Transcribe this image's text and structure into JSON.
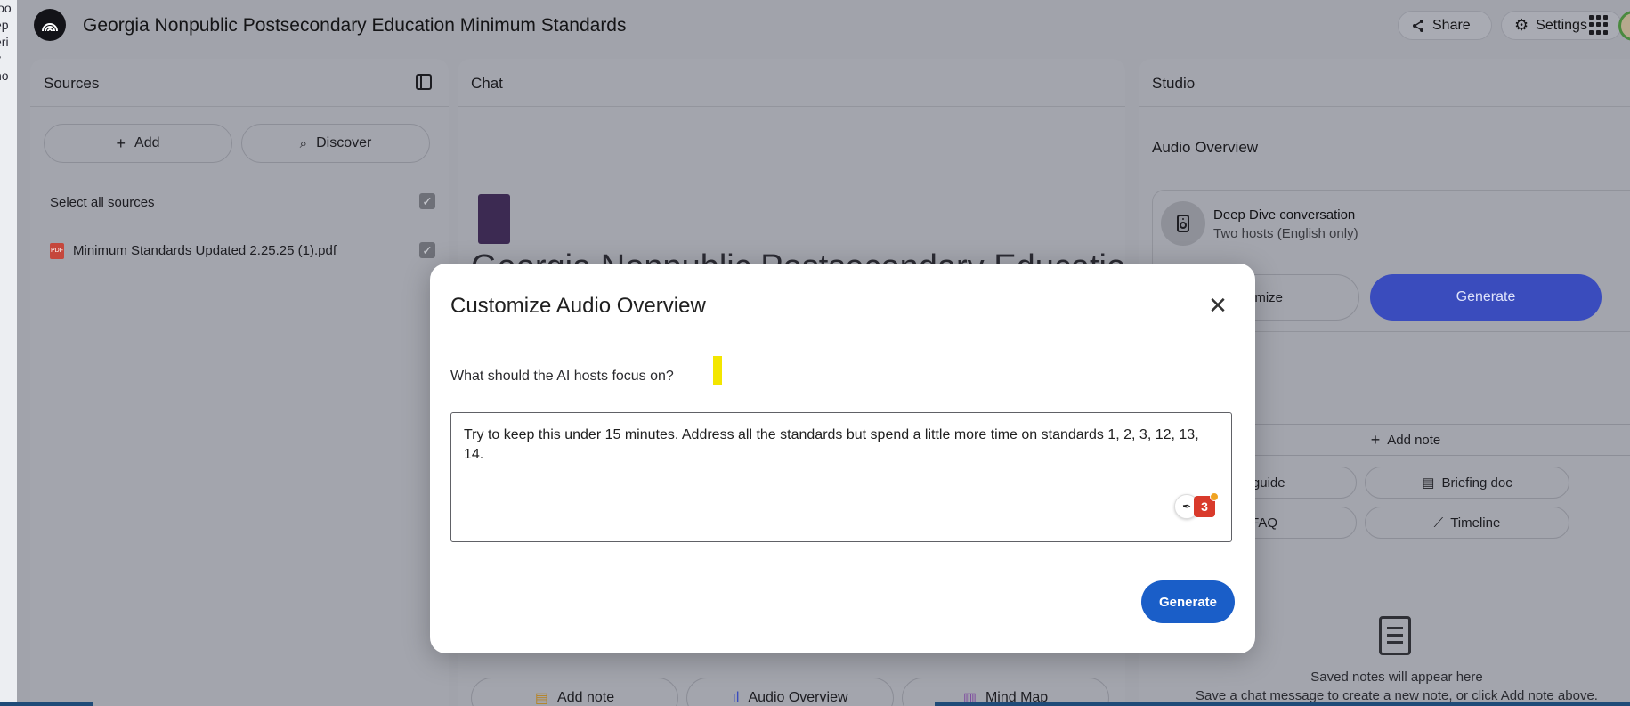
{
  "edge_text": [
    "loo",
    "ep",
    "eri",
    "y",
    "ho"
  ],
  "header": {
    "app_title": "Georgia Nonpublic Postsecondary Education Minimum Standards",
    "share_label": "Share",
    "settings_label": "Settings"
  },
  "sources": {
    "title": "Sources",
    "add_label": "Add",
    "discover_label": "Discover",
    "select_all_label": "Select all sources",
    "items": [
      {
        "name": "Minimum Standards Updated 2.25.25 (1).pdf",
        "checked": true
      }
    ]
  },
  "chat": {
    "title": "Chat",
    "notebook_title": "Georgia Nonpublic Postsecondary Education",
    "bottom_buttons": [
      "Add note",
      "Audio Overview",
      "Mind Map"
    ]
  },
  "studio": {
    "title": "Studio",
    "audio_overview_label": "Audio Overview",
    "deep_dive_title": "Deep Dive conversation",
    "deep_dive_sub": "Two hosts (English only)",
    "customize_label": "ustomize",
    "generate_label": "Generate",
    "add_note_label": "Add note",
    "study_guide_label": "tudy guide",
    "briefing_doc_label": "Briefing doc",
    "faq_label": "FAQ",
    "timeline_label": "Timeline",
    "saved_title": "Saved notes will appear here",
    "saved_sub": "Save a chat message to create a new note, or click Add note above."
  },
  "modal": {
    "title": "Customize Audio Overview",
    "focus_label": "What should the AI hosts focus on?",
    "textarea_value": "Try to keep this under 15 minutes. Address all the standards but spend a little more time on standards 1, 2, 3, 12, 13, 14.",
    "grammarly_count": "3",
    "generate_label": "Generate"
  },
  "colors": {
    "primary_blue": "#1a5ec8",
    "studio_generate": "#3a4cbd",
    "highlight": "#f3e600",
    "grammarly_red": "#d93a2b"
  }
}
